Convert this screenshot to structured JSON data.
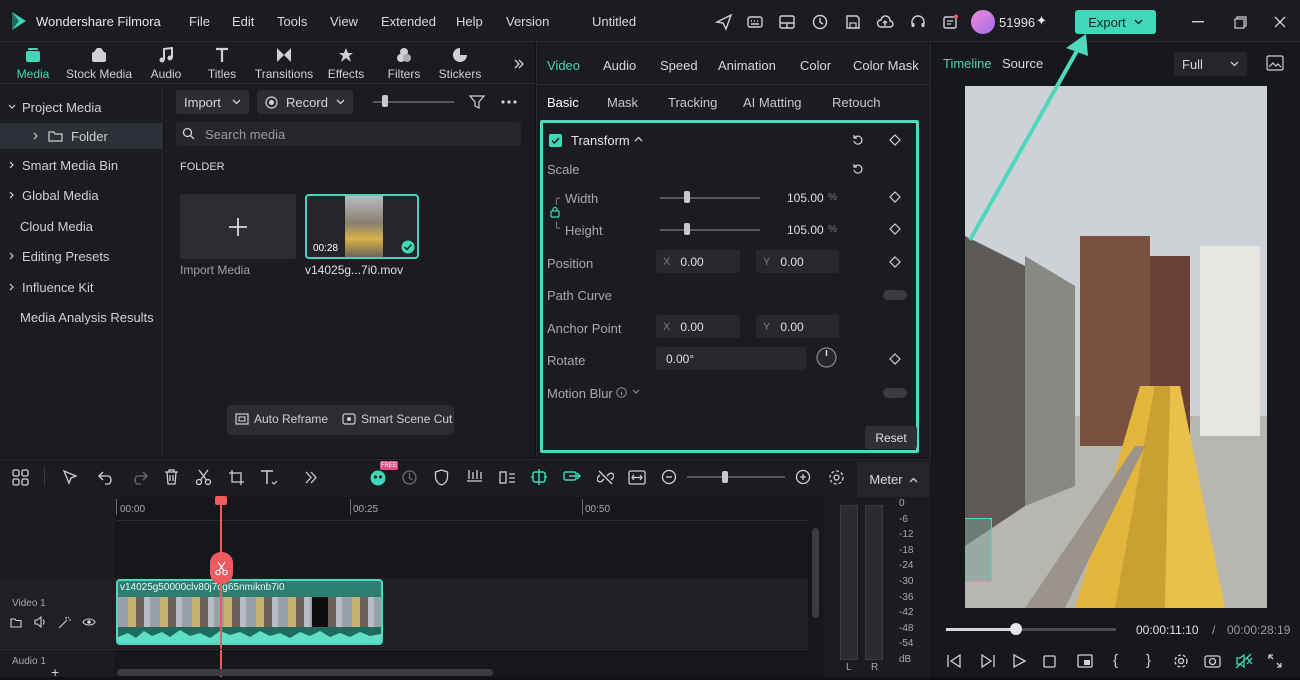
{
  "app": {
    "name": "Wondershare Filmora",
    "project_title": "Untitled",
    "credits": "51996",
    "export_label": "Export"
  },
  "menu": [
    "File",
    "Edit",
    "Tools",
    "View",
    "Extended",
    "Help",
    "Version"
  ],
  "lib_tabs": [
    "Media",
    "Stock Media",
    "Audio",
    "Titles",
    "Transitions",
    "Effects",
    "Filters",
    "Stickers"
  ],
  "sidebar": {
    "items": [
      {
        "label": "Project Media"
      },
      {
        "label": "Folder"
      },
      {
        "label": "Smart Media Bin"
      },
      {
        "label": "Global Media"
      },
      {
        "label": "Cloud Media"
      },
      {
        "label": "Editing Presets"
      },
      {
        "label": "Influence Kit"
      },
      {
        "label": "Media Analysis Results"
      }
    ]
  },
  "media": {
    "import_label": "Import",
    "record_label": "Record",
    "search_placeholder": "Search media",
    "folder_heading": "FOLDER",
    "import_media_label": "Import Media",
    "clip_name": "v14025g...7i0.mov",
    "clip_duration": "00:28",
    "auto_reframe": "Auto Reframe",
    "smart_scene_cut": "Smart Scene Cut"
  },
  "inspector": {
    "tabs": [
      "Video",
      "Audio",
      "Speed",
      "Animation",
      "Color",
      "Color Mask"
    ],
    "sub_tabs": [
      "Basic",
      "Mask",
      "Tracking",
      "AI Matting",
      "Retouch"
    ],
    "transform_label": "Transform",
    "scale_label": "Scale",
    "width_label": "Width",
    "width_value": "105.00",
    "height_label": "Height",
    "height_value": "105.00",
    "percent": "%",
    "position_label": "Position",
    "x_label": "X",
    "y_label": "Y",
    "position_x": "0.00",
    "position_y": "0.00",
    "path_curve_label": "Path Curve",
    "anchor_label": "Anchor Point",
    "anchor_x": "0.00",
    "anchor_y": "0.00",
    "rotate_label": "Rotate",
    "rotate_value": "0.00°",
    "motion_blur_label": "Motion Blur",
    "reset_label": "Reset"
  },
  "preview": {
    "tab_timeline": "Timeline",
    "tab_source": "Source",
    "quality": "Full",
    "current_time": "00:00:11:10",
    "separator": "/",
    "total_time": "00:00:28:19",
    "progress": 0.41
  },
  "timeline": {
    "meter_label": "Meter",
    "ticks": [
      "00:00",
      "00:25",
      "00:50"
    ],
    "video_track_label": "Video 1",
    "audio_track_label": "Audio 1",
    "clip_label": "v14025g50000clv80j7cg65nmiknb7i0",
    "db_scale": [
      "0",
      "-6",
      "-12",
      "-18",
      "-24",
      "-30",
      "-36",
      "-42",
      "-48",
      "-54",
      "dB"
    ],
    "meter_l": "L",
    "meter_r": "R",
    "free_badge": "FREE"
  },
  "colors": {
    "accent": "#3fd8b8",
    "playhead": "#f0595e",
    "clip": "#2a7f70"
  }
}
